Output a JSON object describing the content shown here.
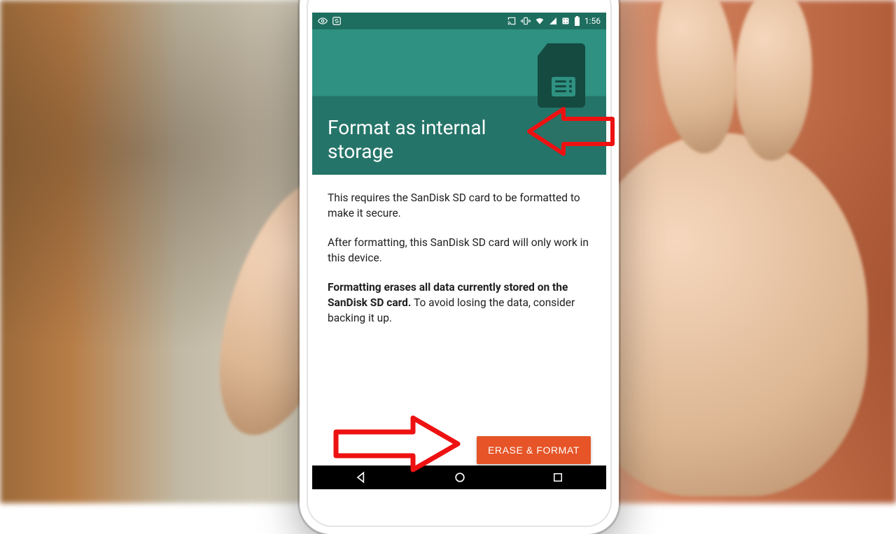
{
  "status": {
    "time": "1:56"
  },
  "header": {
    "title": "Format as internal storage"
  },
  "body": {
    "p1": "This requires the SanDisk SD card to be formatted to make it secure.",
    "p2": "After formatting, this SanDisk SD card will only work in this device.",
    "p3_bold": "Formatting erases all data currently stored on the SanDisk SD card.",
    "p3_rest": " To avoid losing the data, consider backing it up."
  },
  "button": {
    "label": "ERASE & FORMAT"
  }
}
